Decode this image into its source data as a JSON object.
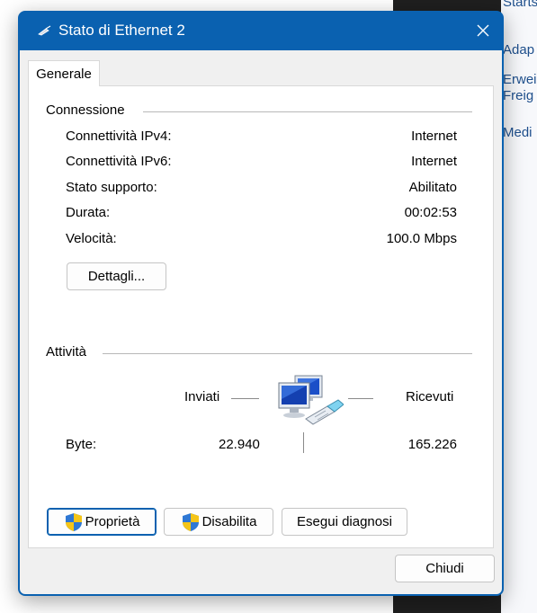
{
  "window": {
    "title": "Stato di Ethernet 2",
    "title_icon": "network-cable-icon",
    "close_icon": "close-icon",
    "accent_color": "#0a61b0"
  },
  "tabs": [
    {
      "label": "Generale",
      "selected": true
    }
  ],
  "connection": {
    "section_label": "Connessione",
    "rows": [
      {
        "label": "Connettività IPv4:",
        "value": "Internet"
      },
      {
        "label": "Connettività IPv6:",
        "value": "Internet"
      },
      {
        "label": "Stato supporto:",
        "value": "Abilitato"
      },
      {
        "label": "Durata:",
        "value": "00:02:53"
      },
      {
        "label": "Velocità:",
        "value": "100.0 Mbps"
      }
    ],
    "details_button": "Dettagli..."
  },
  "activity": {
    "section_label": "Attività",
    "sent_label": "Inviati",
    "received_label": "Ricevuti",
    "bytes_label": "Byte:",
    "bytes_sent": "22.940",
    "bytes_received": "165.226",
    "icon": "network-computers-icon"
  },
  "action_buttons": {
    "properties": "Proprietà",
    "disable": "Disabilita",
    "diagnose": "Esegui diagnosi",
    "shield_icon": "uac-shield-icon"
  },
  "footer": {
    "close_button": "Chiudi"
  },
  "background": {
    "links": [
      "Starts",
      "Adap",
      "Erwei",
      "Freig",
      "Medi"
    ]
  }
}
